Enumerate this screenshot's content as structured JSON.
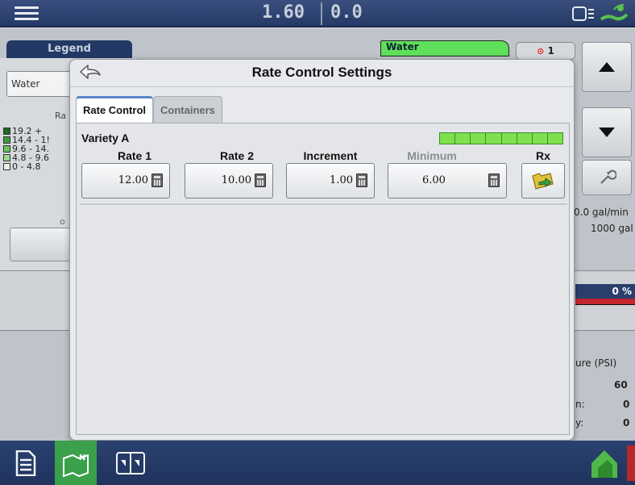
{
  "topbar": {
    "value1": "1.60",
    "value2": "0.0"
  },
  "background": {
    "legend_tab": "Legend",
    "product_box": "Water",
    "rate_label": "Ra",
    "legend_items": [
      {
        "label": "19.2 +",
        "color": "#1f6b1f"
      },
      {
        "label": "14.4 - 1!",
        "color": "#3f9b3a"
      },
      {
        "label": "9.6 - 14.",
        "color": "#6cc35e"
      },
      {
        "label": "4.8 - 9.6",
        "color": "#9bd98a"
      },
      {
        "label": "0 - 4.8",
        "color": "#e7f5e0"
      }
    ],
    "water_tab": "Water",
    "badge": "1",
    "flow_rate": "0.0 gal/min",
    "tank": "1000 gal",
    "percent": "0 %",
    "pressure_label": "ure (PSI)",
    "pressure_value": "60",
    "row_n_label": "n:",
    "row_n_value": "0",
    "row_y_label": "y:",
    "row_y_value": "0",
    "o_mark": "o"
  },
  "dialog": {
    "title": "Rate Control Settings",
    "tabs": [
      {
        "label": "Rate Control",
        "active": true
      },
      {
        "label": "Containers",
        "active": false
      }
    ],
    "variety": "Variety A",
    "segments": 8,
    "accent_green": "#7de04c",
    "columns": [
      {
        "label": "Rate 1",
        "value": "12.00"
      },
      {
        "label": "Rate 2",
        "value": "10.00"
      },
      {
        "label": "Increment",
        "value": "1.00"
      },
      {
        "label": "Minimum",
        "value": "6.00"
      },
      {
        "label": "Rx"
      }
    ]
  }
}
